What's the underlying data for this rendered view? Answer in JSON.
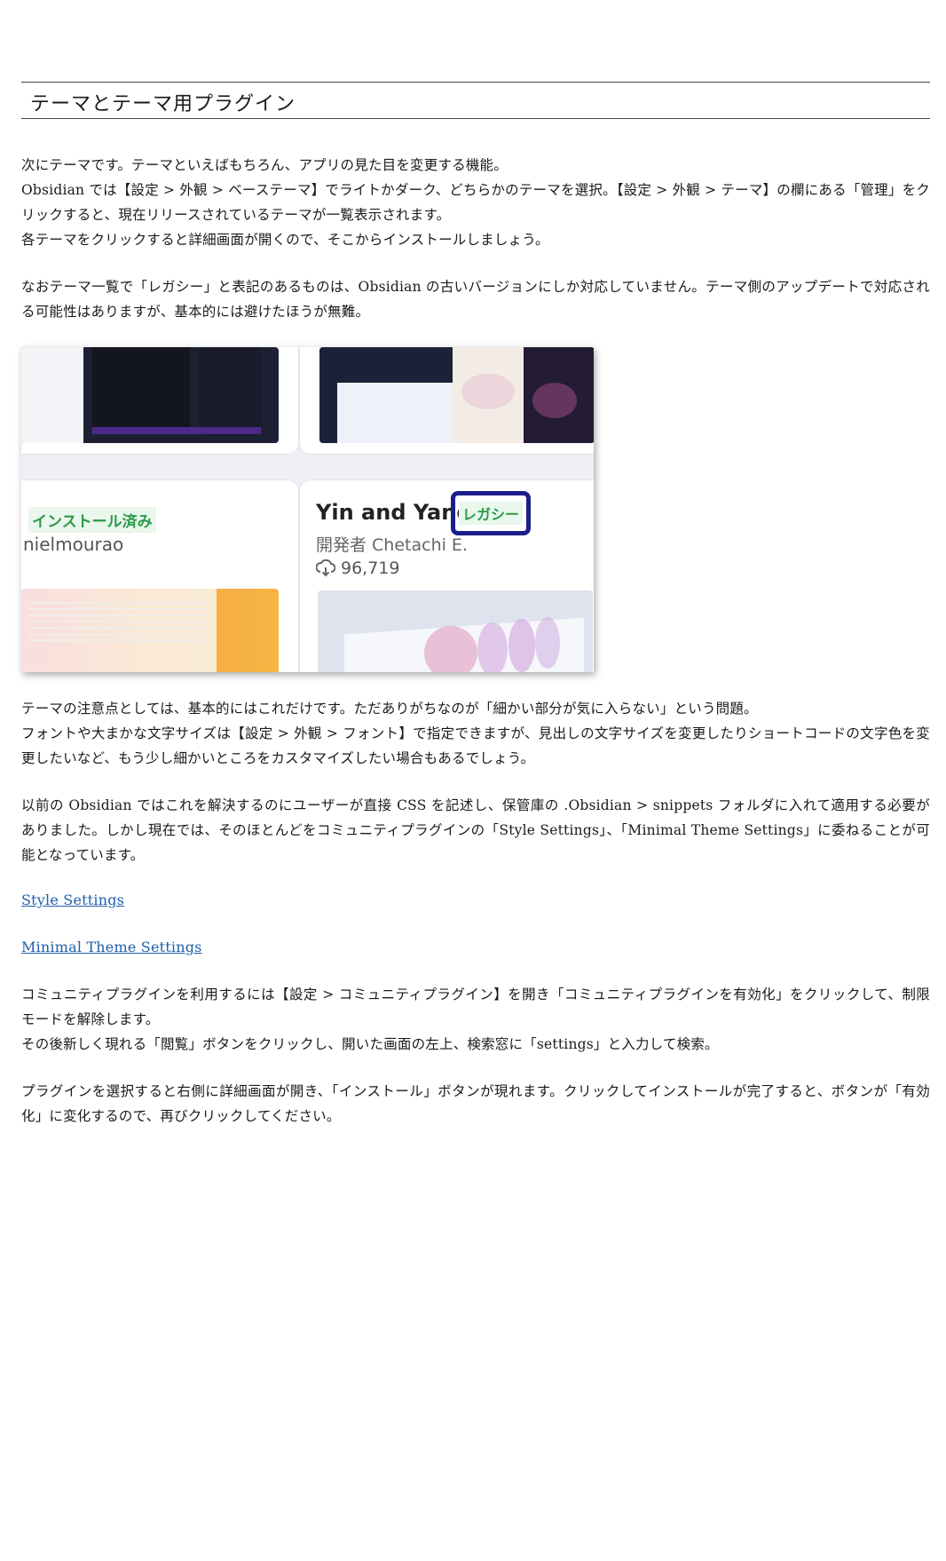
{
  "section": {
    "heading": "テーマとテーマ用プラグイン"
  },
  "paragraphs": {
    "p1": "次にテーマです。テーマといえばもちろん、アプリの見た目を変更する機能。",
    "p2": "Obsidian では【設定 > 外観 > ベーステーマ】でライトかダーク、どちらかのテーマを選択。【設定 > 外観 > テーマ】の欄にある「管理」をクリックすると、現在リリースされているテーマが一覧表示されます。",
    "p3": "各テーマをクリックすると詳細画面が開くので、そこからインストールしましょう。",
    "p4": "なおテーマ一覧で「レガシー」と表記のあるものは、Obsidian の古いバージョンにしか対応していません。テーマ側のアップデートで対応される可能性はありますが、基本的には避けたほうが無難。",
    "p5": "テーマの注意点としては、基本的にはこれだけです。ただありがちなのが「細かい部分が気に入らない」という問題。",
    "p6": "フォントや大まかな文字サイズは【設定 > 外観 > フォント】で指定できますが、見出しの文字サイズを変更したりショートコードの文字色を変更したいなど、もう少し細かいところをカスタマイズしたい場合もあるでしょう。",
    "p7": "以前の Obsidian ではこれを解決するのにユーザーが直接 CSS を記述し、保管庫の .Obsidian > snippets フォルダに入れて適用する必要がありました。しかし現在では、そのほとんどをコミュニティプラグインの「Style Settings」、「Minimal Theme Settings」に委ねることが可能となっています。",
    "p8": "コミュニティプラグインを利用するには【設定 > コミュニティプラグイン】を開き「コミュニティプラグインを有効化」をクリックして、制限モードを解除します。",
    "p9": "その後新しく現れる「閲覧」ボタンをクリックし、開いた画面の左上、検索窓に「settings」と入力して検索。",
    "p10": "プラグインを選択すると右側に詳細画面が開き、「インストール」ボタンが現れます。クリックしてインストールが完了すると、ボタンが「有効化」に変化するので、再びクリックしてください。"
  },
  "links": {
    "style_settings": "Style Settings",
    "minimal_theme_settings": "Minimal Theme Settings"
  },
  "figure": {
    "installed_badge": "インストール済み",
    "left_author": "nielmourao",
    "theme_name": "Yin and Yang",
    "legacy_badge": "レガシー",
    "developer": "開発者 Chetachi E.",
    "downloads": "96,719",
    "highlight_color": "#1b1f8a",
    "badge_color": "#2d9a4a"
  }
}
